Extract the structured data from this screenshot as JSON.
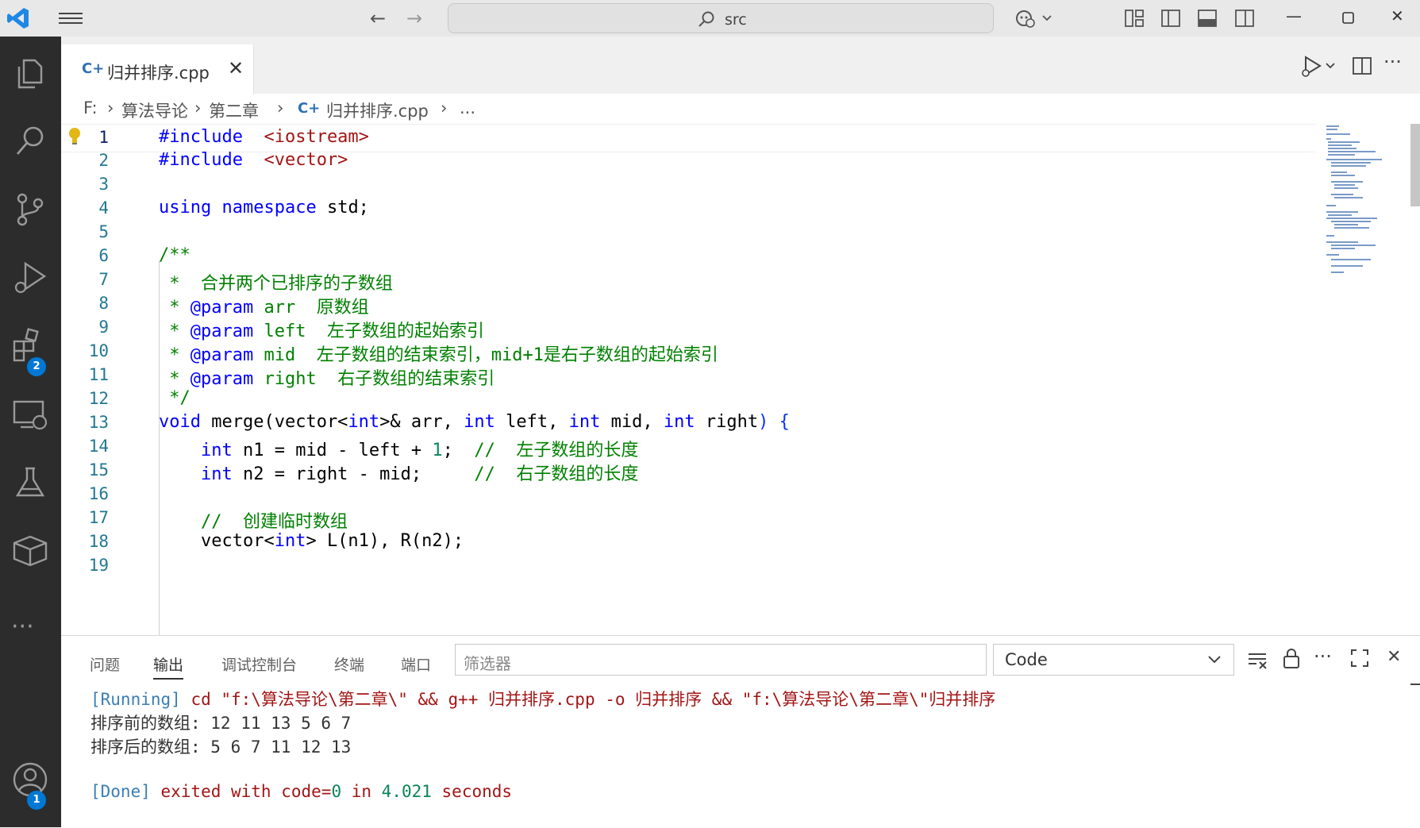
{
  "titlebar": {
    "search_text": "src"
  },
  "activity_bar": {
    "extensions_badge": "2",
    "accounts_badge": "1"
  },
  "tab": {
    "icon_text": "C+",
    "filename": "归并排序.cpp",
    "close_glyph": "✕"
  },
  "breadcrumbs": {
    "drive": "F:",
    "folder1": "算法导论",
    "folder2": "第二章",
    "icon_text": "C+",
    "file": "归并排序.cpp",
    "more": "..."
  },
  "editor": {
    "lines": [
      {
        "n": "1",
        "tokens": [
          [
            "kw",
            "#include"
          ],
          [
            "",
            "  "
          ],
          [
            "str",
            "<iostream>"
          ]
        ]
      },
      {
        "n": "2",
        "tokens": [
          [
            "kw",
            "#include"
          ],
          [
            "",
            "  "
          ],
          [
            "str",
            "<vector>"
          ]
        ]
      },
      {
        "n": "3",
        "tokens": []
      },
      {
        "n": "4",
        "tokens": [
          [
            "kw",
            "using"
          ],
          [
            "",
            " "
          ],
          [
            "kw",
            "namespace"
          ],
          [
            "",
            " std;"
          ]
        ]
      },
      {
        "n": "5",
        "tokens": []
      },
      {
        "n": "6",
        "tokens": [
          [
            "cm",
            "/**"
          ]
        ]
      },
      {
        "n": "7",
        "tokens": [
          [
            "cm",
            " *  合并两个已排序的子数组"
          ]
        ]
      },
      {
        "n": "8",
        "tokens": [
          [
            "cm",
            " * "
          ],
          [
            "cmtag",
            "@param"
          ],
          [
            "cm",
            " arr  原数组"
          ]
        ]
      },
      {
        "n": "9",
        "tokens": [
          [
            "cm",
            " * "
          ],
          [
            "cmtag",
            "@param"
          ],
          [
            "cm",
            " left  左子数组的起始索引"
          ]
        ]
      },
      {
        "n": "10",
        "tokens": [
          [
            "cm",
            " * "
          ],
          [
            "cmtag",
            "@param"
          ],
          [
            "cm",
            " mid  左子数组的结束索引，mid+1是右子数组的起始索引"
          ]
        ]
      },
      {
        "n": "11",
        "tokens": [
          [
            "cm",
            " * "
          ],
          [
            "cmtag",
            "@param"
          ],
          [
            "cm",
            " right  右子数组的结束索引"
          ]
        ]
      },
      {
        "n": "12",
        "tokens": [
          [
            "cm",
            " */"
          ]
        ]
      },
      {
        "n": "13",
        "tokens": [
          [
            "kw",
            "void"
          ],
          [
            "fn",
            " merge"
          ],
          [
            "",
            "(vector<"
          ],
          [
            "ty",
            "int"
          ],
          [
            "",
            "&gt;& arr, "
          ],
          [
            "ty",
            "int"
          ],
          [
            "",
            " left, "
          ],
          [
            "ty",
            "int"
          ],
          [
            "",
            " mid, "
          ],
          [
            "ty",
            "int"
          ],
          [
            "",
            " right"
          ],
          [
            "br",
            ")"
          ],
          [
            "",
            " "
          ],
          [
            "br",
            "{"
          ]
        ]
      },
      {
        "n": "14",
        "tokens": [
          [
            "",
            "    "
          ],
          [
            "ty",
            "int"
          ],
          [
            "",
            " n1 = mid - left + "
          ],
          [
            "num",
            "1"
          ],
          [
            "",
            ";  "
          ],
          [
            "cm",
            "//  左子数组的长度"
          ]
        ]
      },
      {
        "n": "15",
        "tokens": [
          [
            "",
            "    "
          ],
          [
            "ty",
            "int"
          ],
          [
            "",
            " n2 = right - mid;     "
          ],
          [
            "cm",
            "//  右子数组的长度"
          ]
        ]
      },
      {
        "n": "16",
        "tokens": []
      },
      {
        "n": "17",
        "tokens": [
          [
            "",
            "    "
          ],
          [
            "cm",
            "//  创建临时数组"
          ]
        ]
      },
      {
        "n": "18",
        "tokens": [
          [
            "",
            "    vector<"
          ],
          [
            "ty",
            "int"
          ],
          [
            "",
            "&gt; L(n1), R(n2);"
          ]
        ]
      },
      {
        "n": "19",
        "tokens": []
      }
    ]
  },
  "panel": {
    "tabs": [
      "问题",
      "输出",
      "调试控制台",
      "终端",
      "端口"
    ],
    "active_tab": 1,
    "filter_placeholder": "筛选器",
    "channel": "Code",
    "output": {
      "running_tag": "[Running]",
      "running_cmd": " cd \"f:\\算法导论\\第二章\\\" && g++ 归并排序.cpp -o 归并排序 && \"f:\\算法导论\\第二章\\\"归并排序",
      "line1": "排序前的数组: 12 11 13 5 6 7",
      "line2": "排序后的数组: 5 6 7 11 12 13",
      "done_tag": "[Done]",
      "done_text1": " exited with code=",
      "done_code": "0",
      "done_text2": " in ",
      "done_seconds": "4.021",
      "done_text3": " seconds"
    }
  }
}
